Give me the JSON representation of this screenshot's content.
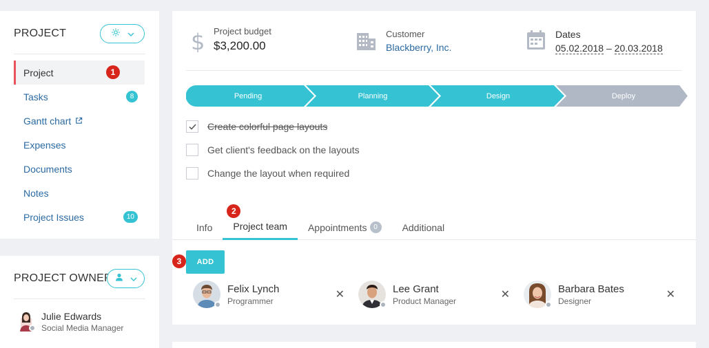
{
  "sidebar": {
    "title": "PROJECT",
    "items": [
      {
        "label": "Project",
        "badge": ""
      },
      {
        "label": "Tasks",
        "badge": "8"
      },
      {
        "label": "Gantt chart",
        "badge": ""
      },
      {
        "label": "Expenses",
        "badge": ""
      },
      {
        "label": "Documents",
        "badge": ""
      },
      {
        "label": "Notes",
        "badge": ""
      },
      {
        "label": "Project Issues",
        "badge": "10"
      }
    ]
  },
  "owner": {
    "title": "PROJECT OWNER",
    "name": "Julie Edwards",
    "role": "Social Media Manager"
  },
  "header": {
    "budget_label": "Project budget",
    "budget_value": "$3,200.00",
    "customer_label": "Customer",
    "customer_value": "Blackberry, Inc.",
    "dates_label": "Dates",
    "date_start": "05.02.2018",
    "date_sep": "–",
    "date_end": "20.03.2018"
  },
  "stages": [
    {
      "label": "Pending",
      "state": "done"
    },
    {
      "label": "Planning",
      "state": "done"
    },
    {
      "label": "Design",
      "state": "done"
    },
    {
      "label": "Deploy",
      "state": "todo"
    }
  ],
  "tasks": [
    {
      "label": "Create colorful page layouts",
      "checked": true
    },
    {
      "label": "Get client's feedback on the layouts",
      "checked": false
    },
    {
      "label": "Change the layout when required",
      "checked": false
    }
  ],
  "tabs": [
    {
      "label": "Info",
      "badge": ""
    },
    {
      "label": "Project team",
      "badge": ""
    },
    {
      "label": "Appointments",
      "badge": "0"
    },
    {
      "label": "Additional",
      "badge": ""
    }
  ],
  "team": {
    "add_label": "ADD",
    "members": [
      {
        "name": "Felix Lynch",
        "role": "Programmer"
      },
      {
        "name": "Lee Grant",
        "role": "Product Manager"
      },
      {
        "name": "Barbara Bates",
        "role": "Designer"
      }
    ]
  },
  "markers": [
    "1",
    "2",
    "3"
  ],
  "colors": {
    "accent": "#35c3d3",
    "active_border": "#e8525a",
    "marker": "#d8251c",
    "link": "#2b6aa3",
    "stage_todo": "#b0b8c5"
  }
}
